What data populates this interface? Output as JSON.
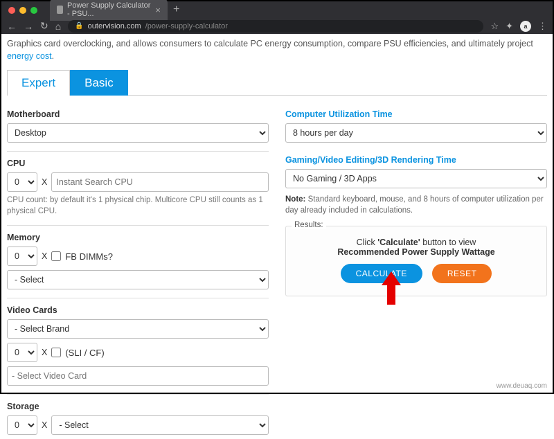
{
  "browser": {
    "tab_title": "Power Supply Calculator - PSU...",
    "url_host": "outervision.com",
    "url_path": "/power-supply-calculator"
  },
  "intro": {
    "text_before": "Graphics card overclocking, and allows consumers to calculate PC energy consumption, compare PSU efficiencies, and ultimately project ",
    "link_text": "energy cost",
    "text_after": "."
  },
  "tabs": {
    "expert": "Expert",
    "basic": "Basic"
  },
  "left": {
    "motherboard_label": "Motherboard",
    "motherboard_value": "Desktop",
    "cpu_label": "CPU",
    "cpu_qty": "0",
    "cpu_x": "X",
    "cpu_placeholder": "Instant Search CPU",
    "cpu_hint": "CPU count: by default it's 1 physical chip. Multicore CPU still counts as 1 physical CPU.",
    "memory_label": "Memory",
    "memory_qty": "0",
    "memory_x": "X",
    "memory_fbdimms": "FB DIMMs?",
    "memory_select": "- Select",
    "video_label": "Video Cards",
    "video_brand": "- Select Brand",
    "video_qty": "0",
    "video_x": "X",
    "video_crossfire": "(SLI / CF)",
    "video_select_card": "- Select Video Card",
    "storage_label": "Storage",
    "storage_qty": "0",
    "storage_x": "X",
    "storage_select": "- Select"
  },
  "right": {
    "util_label": "Computer Utilization Time",
    "util_value": "8 hours per day",
    "gaming_label": "Gaming/Video Editing/3D Rendering Time",
    "gaming_value": "No Gaming / 3D Apps",
    "note_label": "Note:",
    "note_text": " Standard keyboard, mouse, and 8 hours of computer utilization per day already included in calculations.",
    "results_title": "Results:",
    "results_line1_a": "Click ",
    "results_line1_b": "'Calculate'",
    "results_line1_c": " button to view",
    "results_line2": "Recommended Power Supply Wattage",
    "calculate": "CALCULATE",
    "reset": "RESET"
  },
  "watermark": "www.deuaq.com"
}
